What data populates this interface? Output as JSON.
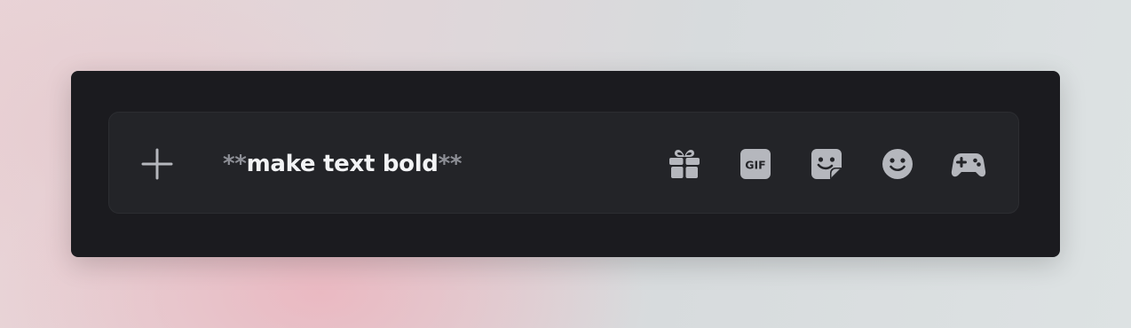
{
  "composer": {
    "message": {
      "prefix_marker": "**",
      "text": "make text bold",
      "suffix_marker": "**"
    },
    "buttons": {
      "attach_icon": "plus-icon",
      "gift_icon": "gift-icon",
      "gif_label": "GIF",
      "sticker_icon": "sticker-icon",
      "emoji_icon": "emoji-icon",
      "apps_icon": "gamepad-icon"
    }
  },
  "colors": {
    "panel_bg": "#1b1b1f",
    "composer_bg": "#232428",
    "icon": "#b5b7bd",
    "text": "#f2f3f5",
    "marker": "#8d8f96"
  }
}
